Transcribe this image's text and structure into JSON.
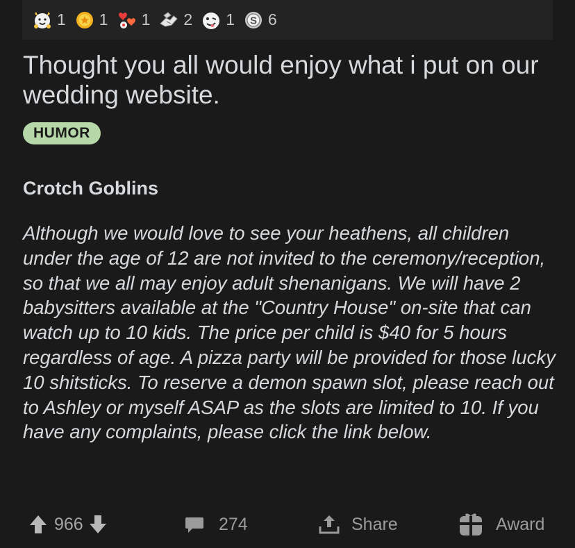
{
  "awards": [
    {
      "icon": "wholesome-cat-icon",
      "count": "1"
    },
    {
      "icon": "gold-medal-icon",
      "count": "1"
    },
    {
      "icon": "heart-eyes-icon",
      "count": "1"
    },
    {
      "icon": "helping-hand-icon",
      "count": "2"
    },
    {
      "icon": "silly-face-icon",
      "count": "1"
    },
    {
      "icon": "silver-coin-icon",
      "count": "6"
    }
  ],
  "post": {
    "title": "Thought you all would enjoy what i put on our wedding website.",
    "flair": "HUMOR",
    "flair_color": "#b6d7a8",
    "heading": "Crotch Goblins",
    "body": "Although we would love to see your heathens, all children under the age of 12  are not invited to the ceremony/reception, so that we all may enjoy adult shenanigans. We will have 2 babysitters available at the \"Country  House\" on-site that can watch up to 10 kids. The price per child is $40  for 5 hours regardless of age. A pizza party will be provided for those lucky 10 shitsticks. To reserve a demon spawn slot, please reach out to  Ashley or myself ASAP as the slots are limited to 10. If you have any complaints, please click the link below."
  },
  "actions": {
    "votes": "966",
    "comments": "274",
    "share_label": "Share",
    "award_label": "Award"
  },
  "colors": {
    "background": "#1a1a1b",
    "text": "#d7dadc",
    "muted": "#9b9b9c"
  }
}
